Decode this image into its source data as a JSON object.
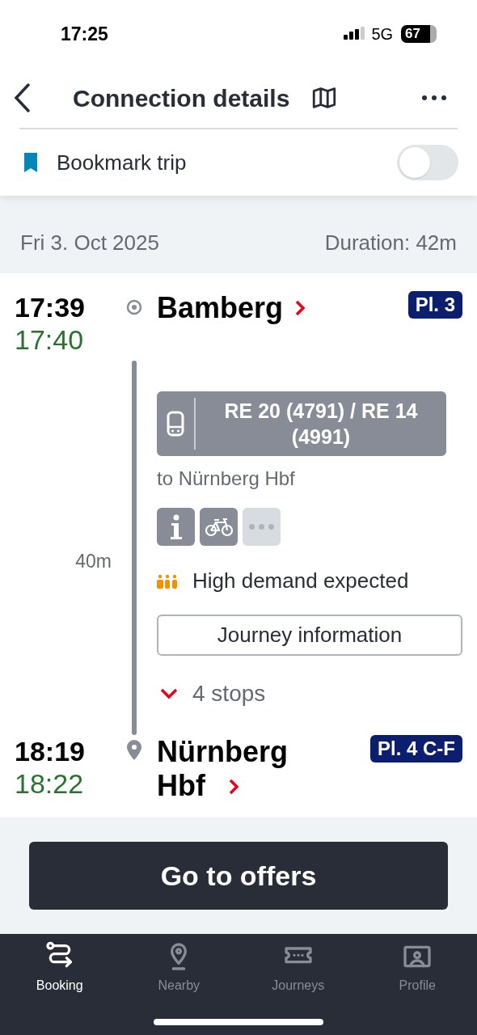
{
  "status_bar": {
    "time": "17:25",
    "network": "5G",
    "battery": "67"
  },
  "header": {
    "title": "Connection details"
  },
  "bookmark": {
    "label": "Bookmark trip",
    "on": false
  },
  "summary": {
    "date": "Fri 3. Oct 2025",
    "duration": "Duration: 42m"
  },
  "departure": {
    "time": "17:39",
    "actual_time": "17:40",
    "station": "Bamberg",
    "platform": "Pl. 3"
  },
  "train": {
    "name": "RE 20 (4791) / RE 14 (4991)",
    "destination": "to Nürnberg Hbf",
    "travel_time": "40m",
    "demand": "High demand expected",
    "journey_button": "Journey information",
    "stops": "4 stops",
    "stops_expanded": false
  },
  "arrival": {
    "time": "18:19",
    "actual_time": "18:22",
    "station": "Nürnberg Hbf",
    "platform": "Pl. 4 C-F"
  },
  "offers_button": "Go to offers",
  "tabs": [
    {
      "label": "Booking",
      "selected": true,
      "kind": "route"
    },
    {
      "label": "Nearby",
      "selected": false,
      "kind": "pin"
    },
    {
      "label": "Journeys",
      "selected": false,
      "kind": "ticket"
    },
    {
      "label": "Profile",
      "selected": false,
      "kind": "profile"
    }
  ]
}
